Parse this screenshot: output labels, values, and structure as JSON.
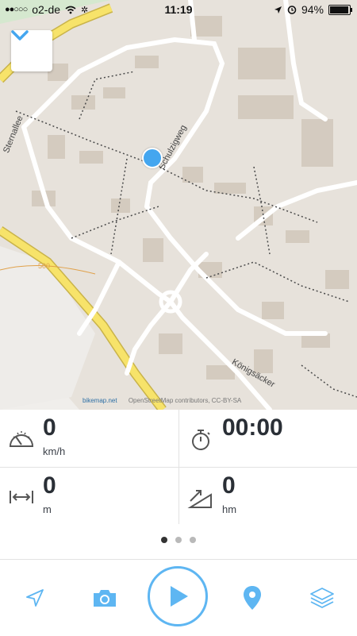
{
  "status_bar": {
    "carrier": "o2-de",
    "time": "11:19",
    "battery": "94%",
    "battery_fraction": 0.94
  },
  "map": {
    "street_labels": [
      "Sternallee",
      "Schulzigweg",
      "Königsäcker"
    ],
    "contour_label": "500",
    "attribution": "OpenStreetMap contributors, CC-BY-SA",
    "logo_text": "bikemap.net"
  },
  "stats": {
    "speed": {
      "value": "0",
      "unit": "km/h",
      "icon": "speedometer-icon"
    },
    "duration": {
      "value": "00:00",
      "icon": "stopwatch-icon"
    },
    "distance": {
      "value": "0",
      "unit": "m",
      "icon": "distance-arrows-icon"
    },
    "elevation": {
      "value": "0",
      "unit": "hm",
      "icon": "elevation-icon"
    },
    "pages": 3,
    "active_page": 1
  },
  "toolbar": {
    "items": [
      "navigate-arrow-icon",
      "camera-icon",
      "play-icon",
      "location-pin-icon",
      "layers-icon"
    ]
  },
  "colors": {
    "accent": "#44a6ef",
    "text": "#2a2f36",
    "map_bg": "#e7e2db",
    "road_major": "#f7e36a"
  }
}
